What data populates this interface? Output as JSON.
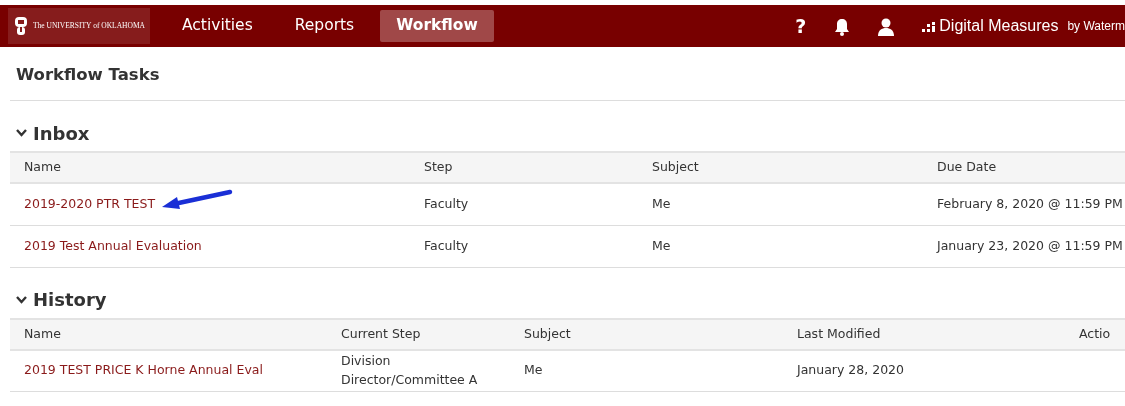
{
  "navbar": {
    "logo": "The UNIVERSITY of OKLAHOMA",
    "items": [
      {
        "label": "Activities",
        "selected": false
      },
      {
        "label": "Reports",
        "selected": false
      },
      {
        "label": "Workflow",
        "selected": true
      }
    ],
    "help": "?",
    "brand": "Digital Measures",
    "brand_suffix": "by Waterm"
  },
  "page_title": "Workflow Tasks",
  "sections": [
    {
      "title": "Inbox",
      "expanded": true,
      "columns": [
        "Name",
        "Step",
        "Subject",
        "Due Date"
      ],
      "rows": [
        {
          "cells": [
            "2019-2020 PTR TEST",
            "Faculty",
            "Me",
            "February 8, 2020 @ 11:59 PM"
          ],
          "annotated": true
        },
        {
          "cells": [
            "2019 Test Annual Evaluation",
            "Faculty",
            "Me",
            "January 23, 2020 @ 11:59 PM"
          ],
          "annotated": false
        }
      ]
    },
    {
      "title": "History",
      "expanded": true,
      "columns": [
        "Name",
        "Current Step",
        "Subject",
        "Last Modified",
        "Actio"
      ],
      "rows": [
        {
          "cells": [
            "2019 TEST PRICE K Horne Annual Eval",
            "Division Director/Committee A",
            "Me",
            "January 28, 2020",
            ""
          ],
          "annotated": false
        }
      ]
    }
  ]
}
